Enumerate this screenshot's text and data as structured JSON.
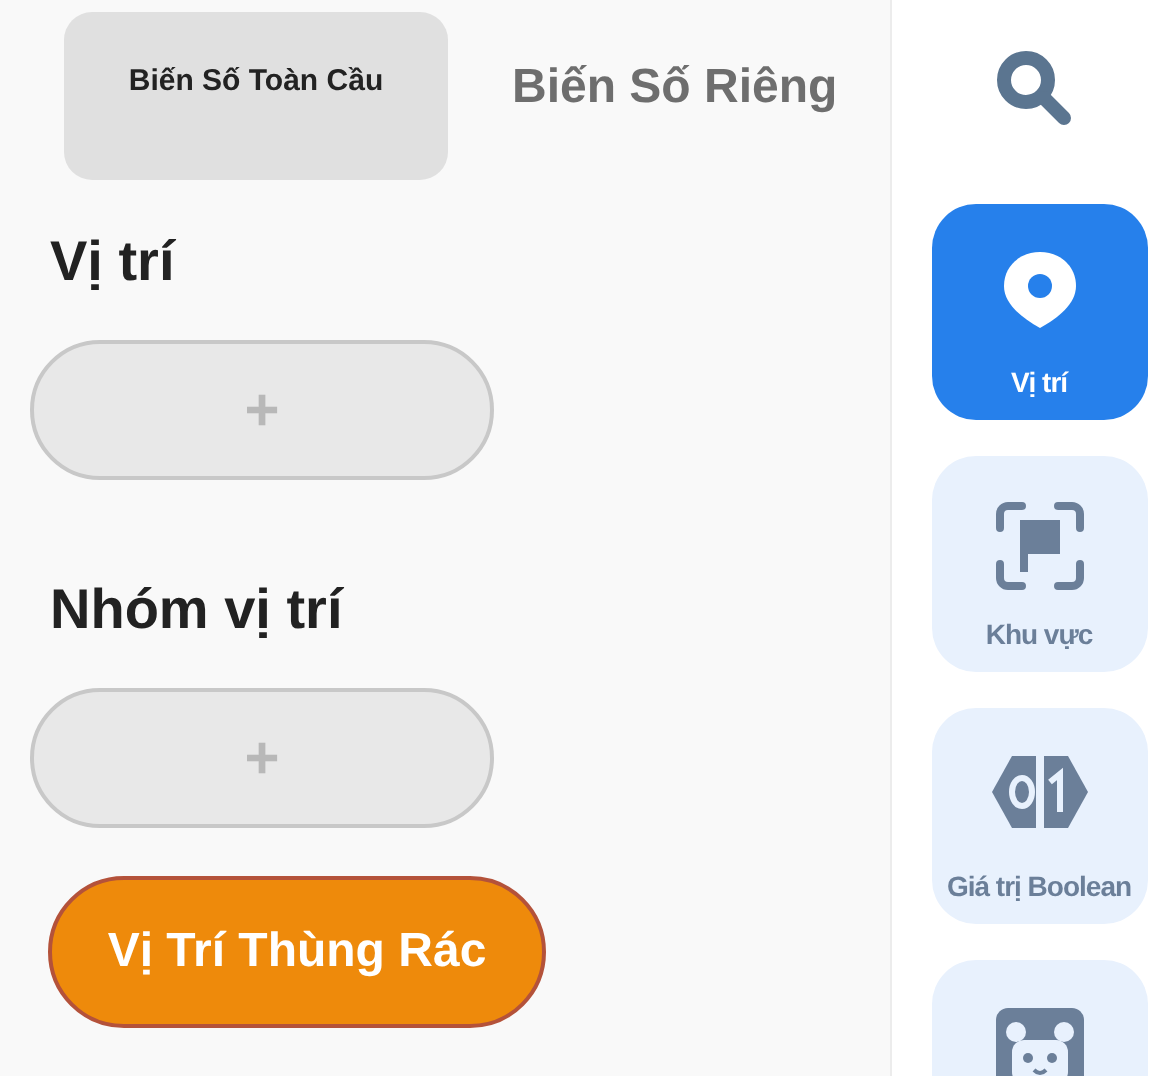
{
  "tabs": [
    {
      "label": "Biến Số Toàn Cầu",
      "selected": true
    },
    {
      "label": "Biến Số Riêng",
      "selected": false
    }
  ],
  "sections": [
    {
      "title": "Vị trí",
      "add_button": "+"
    },
    {
      "title": "Nhóm vị trí",
      "add_button": "+"
    }
  ],
  "trash_button": "Vị Trí Thùng Rác",
  "categories": [
    {
      "kind": "location",
      "label": "Vị trí",
      "selected": true
    },
    {
      "kind": "area",
      "label": "Khu vực",
      "selected": false
    },
    {
      "kind": "boolean",
      "label": "Giá trị Boolean",
      "selected": false
    },
    {
      "kind": "character",
      "selected": false
    }
  ]
}
